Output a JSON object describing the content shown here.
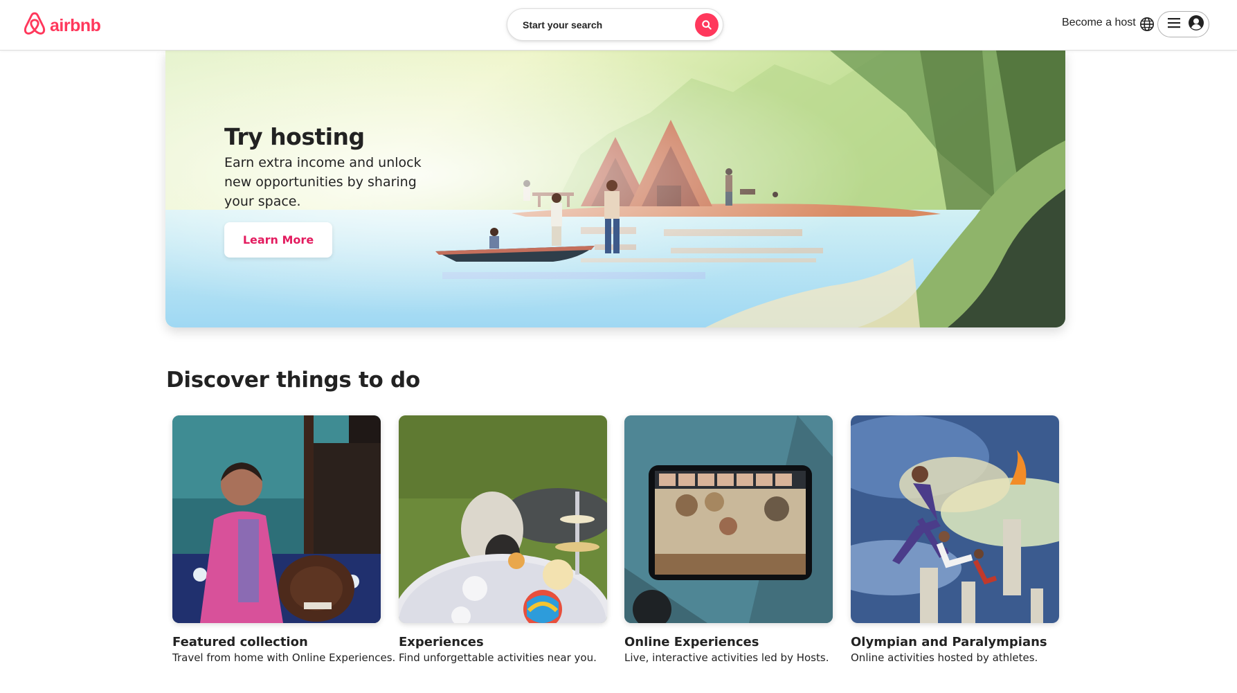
{
  "header": {
    "logo_text": "airbnb",
    "search_placeholder": "Start your search",
    "become_host": "Become a host",
    "icons": {
      "logo": "airbnb-logo-icon",
      "search": "search-icon",
      "globe": "globe-icon",
      "menu": "hamburger-menu-icon",
      "profile": "user-avatar-icon"
    }
  },
  "hero": {
    "title": "Try hosting",
    "subtitle": "Earn extra income and unlock new opportunities by sharing your space.",
    "button_label": "Learn More"
  },
  "discover": {
    "title": "Discover things to do",
    "cards": [
      {
        "title": "Featured collection",
        "subtitle": "Travel from home with Online Experiences."
      },
      {
        "title": "Experiences",
        "subtitle": "Find unforgettable activities near you."
      },
      {
        "title": "Online Experiences",
        "subtitle": "Live, interactive activities led by Hosts."
      },
      {
        "title": "Olympian and Paralympians",
        "subtitle": "Online activities hosted by athletes."
      }
    ]
  },
  "colors": {
    "brand": "#ff385c",
    "button_text": "#e31c5f",
    "text": "#222222",
    "border": "#dddddd"
  }
}
